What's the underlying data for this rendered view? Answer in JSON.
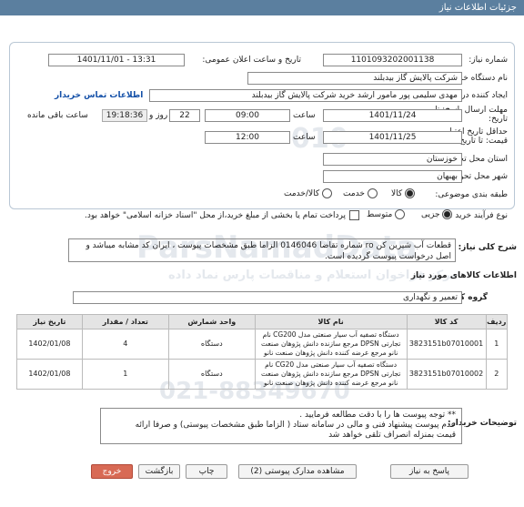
{
  "title": "جزئیات اطلاعات نیاز",
  "need_number": {
    "label": "شماره نیاز:",
    "value": "1101093202001138"
  },
  "announce": {
    "label": "تاریخ و ساعت اعلان عمومی:",
    "value": "1401/11/01 - 13:31"
  },
  "buyer_org": {
    "label": "نام دستگاه خریدار:",
    "value": "شرکت پالایش گاز بیدبلند"
  },
  "creator": {
    "label": "ایجاد کننده درخواست:",
    "value": "مهدی سلیمی پور مامور ارشد خرید شرکت پالایش گاز بیدبلند",
    "contact_link": "اطلاعات تماس خریدار"
  },
  "deadline": {
    "label": "مهلت ارسال پاسخ: تا تاریخ:",
    "date": "1401/11/24",
    "time_label": "ساعت",
    "time": "09:00",
    "days": "22",
    "days_label": "روز و",
    "remaining": "19:18:36",
    "remaining_label": "ساعت باقی مانده"
  },
  "validity": {
    "label": "حداقل تاریخ اعتبار قیمت: تا تاریخ:",
    "date": "1401/11/25",
    "time_label": "ساعت",
    "time": "12:00"
  },
  "province": {
    "label": "استان محل تحویل:",
    "value": "خوزستان"
  },
  "city": {
    "label": "شهر محل تحویل:",
    "value": "بهبهان"
  },
  "category": {
    "label": "طبقه بندی موضوعی:",
    "options": [
      "کالا",
      "خدمت",
      "کالا/خدمت"
    ],
    "selected": "کالا"
  },
  "process": {
    "label": "نوع فرآیند خرید :",
    "options": [
      "جزیی",
      "متوسط"
    ],
    "selected": "جزیی",
    "treasury_note": "پرداخت تمام یا بخشی از مبلغ خرید،از محل \"اسناد خزانه اسلامی\" خواهد بود."
  },
  "general_desc": {
    "label": "شرح کلی نیاز:",
    "value": "قطعات آب شیرین کن ro شماره تقاضا 0146046 الزاما طبق مشخصات پیوست ، ایران کد مشابه میباشد و اصل درخواست پیوست گردیده است."
  },
  "goods_info_title": "اطلاعات کالاهای مورد نیاز",
  "goods_group": {
    "label": "گروه کالا:",
    "value": "تعمیر و نگهداری"
  },
  "table": {
    "headers": [
      "ردیف",
      "کد کالا",
      "نام کالا",
      "واحد شمارش",
      "تعداد / مقدار",
      "تاریخ نیاز"
    ],
    "rows": [
      {
        "idx": "1",
        "code": "3823151b07010001",
        "name": "دستگاه تصفیه آب سیار صنعتی مدل CG200 نام تجارتی DPSN مرجع سازنده دانش پژوهان صنعت نانو مرجع عرضه کننده دانش پژوهان صنعت نانو",
        "unit": "دستگاه",
        "qty": "4",
        "date": "1402/01/08"
      },
      {
        "idx": "2",
        "code": "3823151b07010002",
        "name": "دستگاه تصفیه آب سیار صنعتی مدل CG20 نام تجارتی DPSN مرجع سازنده دانش پژوهان صنعت نانو مرجع عرضه کننده دانش پژوهان صنعت نانو",
        "unit": "دستگاه",
        "qty": "1",
        "date": "1402/01/08"
      }
    ]
  },
  "buyer_notes": {
    "label": "توضیحات خریدار:",
    "lines": [
      "** توجه پیوست ها  را با دقت مطالعه فرمایید .",
      "عدم پیوست پیشنهاد فنی و مالی در سامانه ستاد ( الزاما طبق مشخصات پیوستی)  و صرفا ارائه",
      "قیمت بمنزله انصراف تلقی خواهد شد"
    ]
  },
  "buttons": {
    "reply": "پاسخ به نیاز",
    "docs": "مشاهده مدارک پیوستی (2)",
    "print": "چاپ",
    "back": "بازگشت",
    "exit": "خروج"
  },
  "watermark": {
    "line1": "ParsNamadData",
    "line2": "مرکز فراخوان استعلام و مناقصات پارس نماد داده",
    "phone": "021-88349670"
  }
}
